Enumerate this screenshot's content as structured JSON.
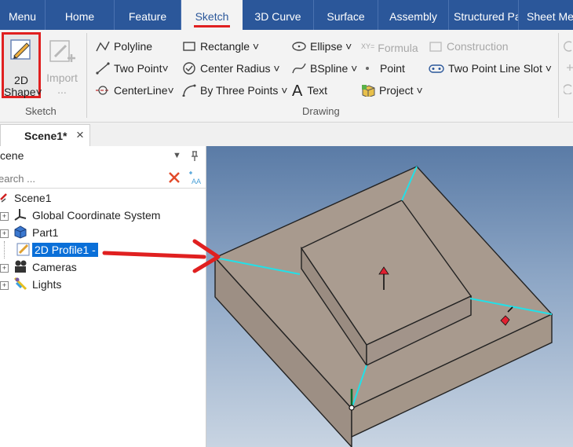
{
  "menu": {
    "tabs": [
      {
        "label": "Menu"
      },
      {
        "label": "Home"
      },
      {
        "label": "Feature"
      },
      {
        "label": "Sketch"
      },
      {
        "label": "3D Curve"
      },
      {
        "label": "Surface"
      },
      {
        "label": "Assembly"
      },
      {
        "label": "Structured Pa"
      },
      {
        "label": "Sheet Me"
      }
    ],
    "active_tab": "Sketch"
  },
  "ribbon": {
    "sketch_group": {
      "shape_2d_line1": "2D",
      "shape_2d_line2": "Shape",
      "import_line1": "Import",
      "import_line2": "...",
      "label": "Sketch"
    },
    "drawing_group": {
      "polyline": "Polyline",
      "two_point": "Two Point",
      "centerline": "CenterLine",
      "rectangle": "Rectangle",
      "center_radius": "Center Radius",
      "by_three_points": "By Three Points",
      "ellipse": "Ellipse",
      "bspline": "BSpline",
      "text": "Text",
      "formula": "Formula",
      "point": "Point",
      "project": "Project",
      "construction": "Construction",
      "two_point_line_slot": "Two Point Line Slot",
      "formula_icon_text": "XY=",
      "label": "Drawing"
    }
  },
  "document_tab": {
    "title": "Scene1*",
    "close": "×"
  },
  "scene_panel": {
    "title": "cene",
    "search_placeholder": "earch ...",
    "tree": [
      {
        "label": "Scene1",
        "selected": false
      },
      {
        "label": "Global Coordinate System",
        "selected": false
      },
      {
        "label": "Part1",
        "selected": false
      },
      {
        "label": "2D Profile1 -",
        "selected": true
      },
      {
        "label": "Cameras",
        "selected": false
      },
      {
        "label": "Lights",
        "selected": false
      }
    ]
  },
  "colors": {
    "menubar": "#2b579a",
    "highlight_red": "#e02020",
    "selection_blue": "#0a6fd8",
    "model_face": "#a89a8e",
    "edge_cyan": "#22e0e8"
  },
  "icons": [
    "sketch-pencil-icon",
    "import-icon",
    "polyline-icon",
    "line-icon",
    "centerline-icon",
    "rectangle-icon",
    "circle-icon",
    "arc-icon",
    "ellipse-icon",
    "bspline-icon",
    "text-icon",
    "formula-icon",
    "point-icon",
    "project-icon",
    "construction-icon",
    "slot-icon",
    "close-icon",
    "dropdown-icon",
    "pin-icon",
    "clear-icon",
    "filter-icon"
  ]
}
